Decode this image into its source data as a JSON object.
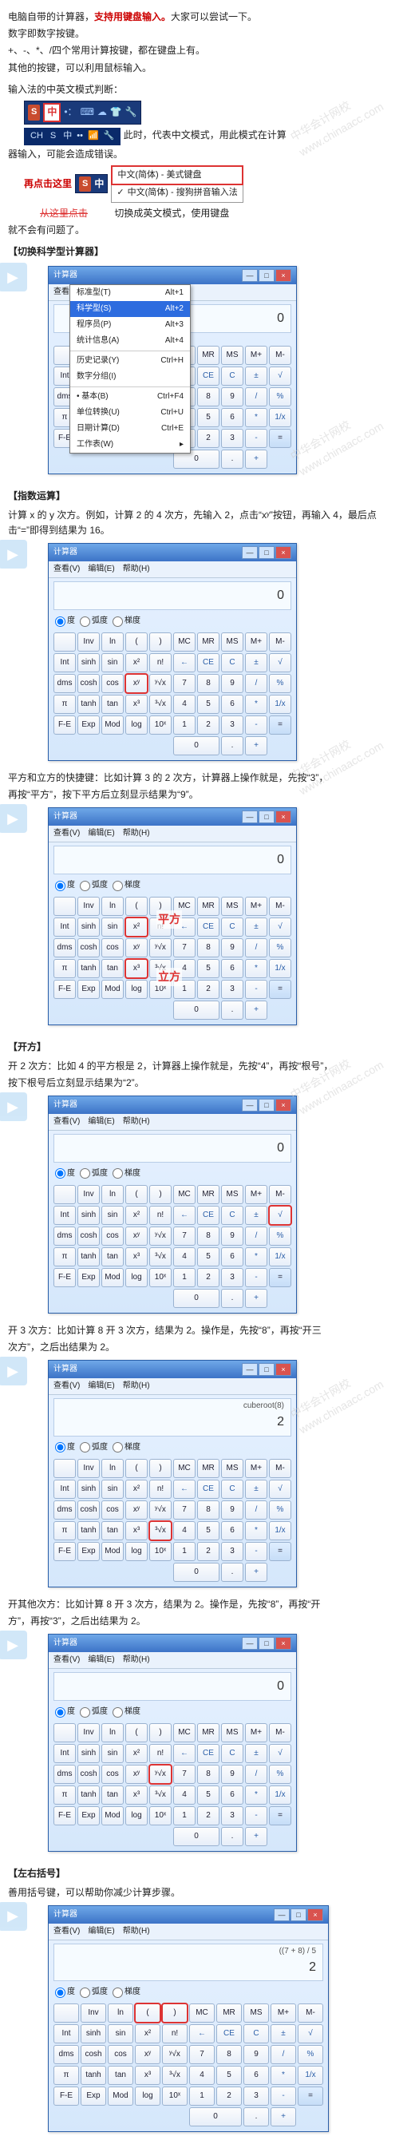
{
  "intro": {
    "l1a": "电脑自带的计算器，",
    "l1b": "支持用键盘输入。",
    "l1c": "大家可以尝试一下。",
    "l2": "数字即数字按键。",
    "l3": "+、-、*、/四个常用计算按键，都在键盘上有。",
    "l4": "其他的按键，可以利用鼠标输入。",
    "l5": "输入法的中英文模式判断："
  },
  "ime": {
    "s": "S",
    "zhong": "中",
    "ch": "CH",
    "after_bar": "此时，代表中文模式，用此模式在计算",
    "err_line": "器输入，可能会造成错误。",
    "click_here": "再点击这里",
    "menu1": "中文(简体) - 美式键盘",
    "menu2": "中文(简体) - 搜狗拼音输入法",
    "switch_en": "切换成英文模式，使用键盘",
    "ok_line": "就不会有问题了。",
    "check": "✓"
  },
  "calc": {
    "title": "计算器",
    "menu_view": "查看(V)",
    "menu_edit": "编辑(E)",
    "menu_help": "帮助(H)",
    "disp0": "0",
    "modes": {
      "deg": "度",
      "rad": "弧度",
      "grad": "梯度"
    },
    "keys": {
      "empty": "",
      "Inv": "Inv",
      "ln": "ln",
      "lp": "(",
      "rp": ")",
      "MC": "MC",
      "MR": "MR",
      "MS": "MS",
      "Mp": "M+",
      "Mm": "M-",
      "Int": "Int",
      "sinh": "sinh",
      "sin": "sin",
      "x2": "x²",
      "nf": "n!",
      "bk": "←",
      "CE": "CE",
      "C": "C",
      "pm": "±",
      "sqrt": "√",
      "dms": "dms",
      "cosh": "cosh",
      "cos": "cos",
      "xy": "xʸ",
      "yx": "ʸ√x",
      "7": "7",
      "8": "8",
      "9": "9",
      "div": "/",
      "pct": "%",
      "pi": "π",
      "tanh": "tanh",
      "tan": "tan",
      "x3": "x³",
      "cbrt": "³√x",
      "4": "4",
      "5": "5",
      "6": "6",
      "mul": "*",
      "inv": "1/x",
      "FE": "F-E",
      "Exp": "Exp",
      "Mod": "Mod",
      "log": "log",
      "tenx": "10ˣ",
      "1": "1",
      "2": "2",
      "3": "3",
      "sub": "-",
      "eq": "=",
      "0": "0",
      "dot": ".",
      "add": "+"
    },
    "view_menu": {
      "std": "标准型(T)",
      "std_k": "Alt+1",
      "sci": "科学型(S)",
      "sci_k": "Alt+2",
      "prog": "程序员(P)",
      "prog_k": "Alt+3",
      "stat": "统计信息(A)",
      "stat_k": "Alt+4",
      "hist": "历史记录(Y)",
      "hist_k": "Ctrl+H",
      "grp": "数字分组(I)",
      "basic": "基本(B)",
      "basic_k": "Ctrl+F4",
      "unit": "单位转换(U)",
      "unit_k": "Ctrl+U",
      "date": "日期计算(D)",
      "date_k": "Ctrl+E",
      "ws": "工作表(W)"
    }
  },
  "sections": {
    "switch_sci": "【切换科学型计算器】",
    "power_title": "【指数运算】",
    "power_text": "计算 x 的 y 次方。例如，计算 2 的 4 次方，先输入 2，点击“xʸ”按钮，再输入 4，最后点击“=”即得到结果为 16。",
    "sq_cube_text_a": "平方和立方的快捷键：比如计算 3 的 2 次方，计算器上操作就是，先按“3”，",
    "sq_cube_text_b": "再按“平方”，按下平方后立刻显示结果为“9”。",
    "sq_label": "平方",
    "cube_label": "立方",
    "root_title": "【开方】",
    "root_text_a": "开 2 次方：比如 4 的平方根是 2，计算器上操作就是，先按“4”，再按“根号”，",
    "root_text_b": "按下根号后立刻显示结果为“2”。",
    "cuberoot_text_a": "开 3 次方：比如计算 8 开 3 次方，结果为 2。操作是，先按“8”，再按“开三",
    "cuberoot_text_b": "次方”，之后出结果为 2。",
    "cuberoot_disp": "cuberoot(8)",
    "cuberoot_val": "2",
    "nroot_text_a": "开其他次方：比如计算 8 开 3 次方，结果为 2。操作是，先按“8”，再按“开",
    "nroot_text_b": "方”，再按“3”，之后出结果为 2。",
    "paren_title": "【左右括号】",
    "paren_text": "善用括号键，可以帮助你减少计算步骤。",
    "paren_disp_small": "((7 + 8) / 5",
    "paren_disp": "2"
  },
  "watermark": "中华会计网校 www.chinaacc.com"
}
